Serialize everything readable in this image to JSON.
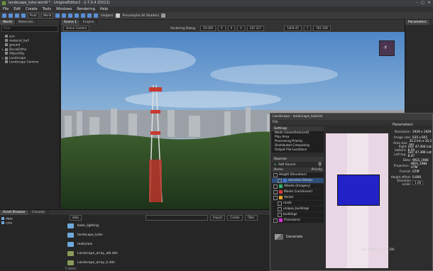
{
  "title": "landscape_tutor.world * - UnigineEditor2 - 2.7.0.4 (DX11)",
  "window_buttons": [
    "–",
    "□",
    "✕"
  ],
  "menu": [
    "File",
    "Edit",
    "Create",
    "Tools",
    "Windows",
    "Rendering",
    "Help"
  ],
  "toolbar": {
    "pivot_label": "Pivot",
    "world_label": "World",
    "helpers_label": "Helpers",
    "precompile_label": "Precompile All Shaders"
  },
  "world_panel": {
    "tabs": [
      "World",
      "Materials"
    ],
    "filter_placeholder": "Filter",
    "items": [
      {
        "label": "sun",
        "expander": ""
      },
      {
        "label": "material_ball",
        "expander": ""
      },
      {
        "label": "ground",
        "expander": ""
      },
      {
        "label": "DecalOrtho",
        "expander": "▸"
      },
      {
        "label": "ObjectSky",
        "expander": ""
      },
      {
        "label": "Landscape",
        "expander": "▸"
      },
      {
        "label": "Landscape Camera",
        "expander": ""
      }
    ]
  },
  "viewport": {
    "tabs": [
      "Scene 1",
      "Engine"
    ],
    "camera_select": "Scene Camera",
    "rendering_debug": "Rendering Debug",
    "fields": [
      "50.000",
      "0",
      "0",
      "0",
      "187.227",
      "1404.45",
      "1",
      "561.108"
    ],
    "axis_gizmo": "-Y"
  },
  "params_panel": {
    "title": "Parameters"
  },
  "asset_browser": {
    "tabs": [
      "Asset Browser",
      "Console"
    ],
    "tree": [
      "data",
      "core"
    ],
    "path": "data",
    "buttons": [
      "Import",
      "Create",
      "Filter"
    ],
    "items": [
      "bake_lighting",
      "landscape_tutor",
      "materials",
      "Landscape_array_alb.dds",
      "Landscape_array_h.dds"
    ],
    "status": "5 items"
  },
  "landscape_window": {
    "title": "Landscape - landscape_tutorial",
    "menu": "File",
    "settings_title": "Settings",
    "settings_items": [
      "Mode (Georeferenced)",
      "Play Area",
      "Processing Priority",
      "Distributed Computing",
      "Output File Locations"
    ],
    "sources_title": "Sources",
    "add_source": "Add Source",
    "columns": [
      "Name",
      "Priority"
    ],
    "sources": [
      {
        "name": "Height (Elevation)",
        "color": "",
        "selected": false
      },
      {
        "name": "elevation2bmps",
        "color": "#4a78c8",
        "selected": true
      },
      {
        "name": "Albedo (Imagery)",
        "color": "#2db36b",
        "selected": false
      },
      {
        "name": "Masks (Landcover)",
        "color": "#d43a3a",
        "selected": false
      },
      {
        "name": "Vector",
        "color": "#e3a02b",
        "selected": false
      },
      {
        "name": "roads",
        "color": "",
        "selected": false
      },
      {
        "name": "unique_buildings",
        "color": "",
        "selected": false
      },
      {
        "name": "buildings",
        "color": "",
        "selected": false
      },
      {
        "name": "Procedural",
        "color": "#d62fd6",
        "selected": false
      }
    ],
    "generate": "Generate",
    "coords": "Lon: 8.486, Lat: 47.396",
    "params_title": "Parameters",
    "params": [
      {
        "label": "Resolution:",
        "value": "1929 x 1929"
      },
      {
        "label": "Image size:",
        "value": "635 x 601"
      },
      {
        "label": "Area size:",
        "value": "35.2 km x 35.2 km"
      },
      {
        "label": "Right bottom:",
        "value": "Lon: 47.404 Lat: 8.50"
      },
      {
        "label": "Left top:",
        "value": "Lon: 47.396 Lat: 8.47"
      },
      {
        "label": "Data:",
        "value": "WGS_1984"
      },
      {
        "label": "Projection:",
        "value": "WGS_1984 UTM"
      },
      {
        "label": "Format:",
        "value": "GTiff"
      },
      {
        "label": "Height offset:",
        "value": "0.000"
      },
      {
        "label": "Elevation scale:",
        "value": "1.00"
      }
    ]
  },
  "colors": {
    "accent": "#5a8fd6",
    "selected_row": "#2d4f7a",
    "preview_rect": "#2222c8"
  }
}
